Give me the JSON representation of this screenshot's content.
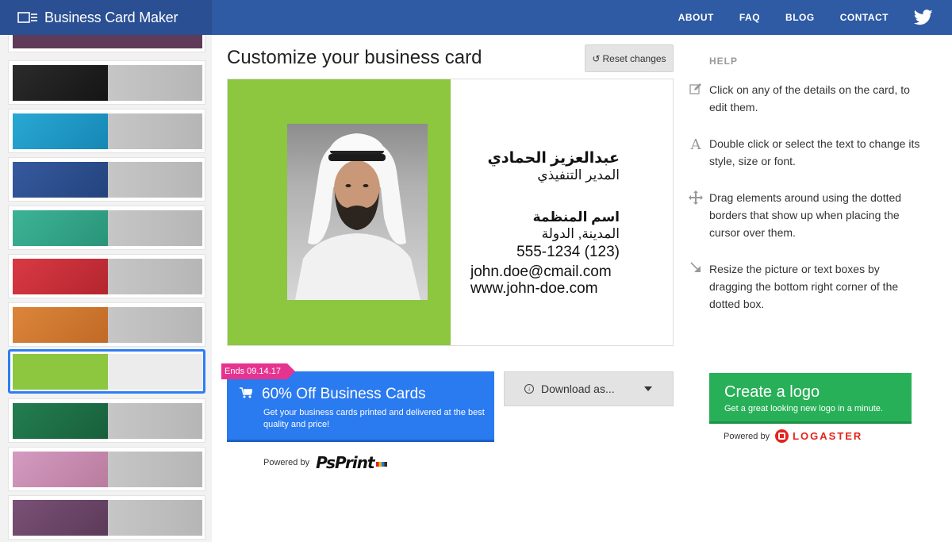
{
  "header": {
    "brand": "Business Card Maker",
    "nav": [
      "ABOUT",
      "FAQ",
      "BLOG",
      "CONTACT"
    ],
    "twitter_icon": "twitter-icon"
  },
  "sidebar": {
    "swatches": [
      {
        "color": "#5e3b58",
        "selected": false
      },
      {
        "color": "#1f1f1f",
        "selected": false
      },
      {
        "color": "#1e9bc9",
        "selected": false
      },
      {
        "color": "#2d4f8f",
        "selected": false
      },
      {
        "color": "#34a98c",
        "selected": false
      },
      {
        "color": "#c9303a",
        "selected": false
      },
      {
        "color": "#d27a31",
        "selected": false
      },
      {
        "color": "#8dc63f",
        "selected": true
      },
      {
        "color": "#1f7448",
        "selected": false
      },
      {
        "color": "#c98fb3",
        "selected": false
      },
      {
        "color": "#6b4468",
        "selected": false
      }
    ]
  },
  "main": {
    "title": "Customize your business card",
    "reset_label": "Reset changes"
  },
  "card": {
    "accent_color": "#8dc63f",
    "name": "عبدالعزيز الحمادي",
    "role": "المدير التنفيذي",
    "organization": "اسم المنظمة",
    "location": "المدينة, الدولة",
    "phone": "555-1234 (123)",
    "email": "john.doe@cmail.com",
    "website": "www.john-doe.com"
  },
  "promo": {
    "badge": "Ends 09.14.17",
    "title": "60% Off Business Cards",
    "subtitle": "Get your business cards printed and delivered at the best quality and price!",
    "powered_by": "Powered by",
    "partner": "PsPrint"
  },
  "download": {
    "label": "Download as..."
  },
  "help": {
    "title": "HELP",
    "items": [
      {
        "icon": "edit-icon",
        "text": "Click on any of the details on the card, to edit them."
      },
      {
        "icon": "font-icon",
        "text": "Double click or select the text to change its style, size or font."
      },
      {
        "icon": "move-icon",
        "text": "Drag elements around using the dotted borders that show up when placing the cursor over them."
      },
      {
        "icon": "resize-icon",
        "text": "Resize the picture or text boxes by dragging the bottom right corner of the dotted box."
      }
    ]
  },
  "logo_promo": {
    "title": "Create a logo",
    "subtitle": "Get a great looking new logo in a minute.",
    "powered_by": "Powered by",
    "partner": "LOGASTER"
  }
}
